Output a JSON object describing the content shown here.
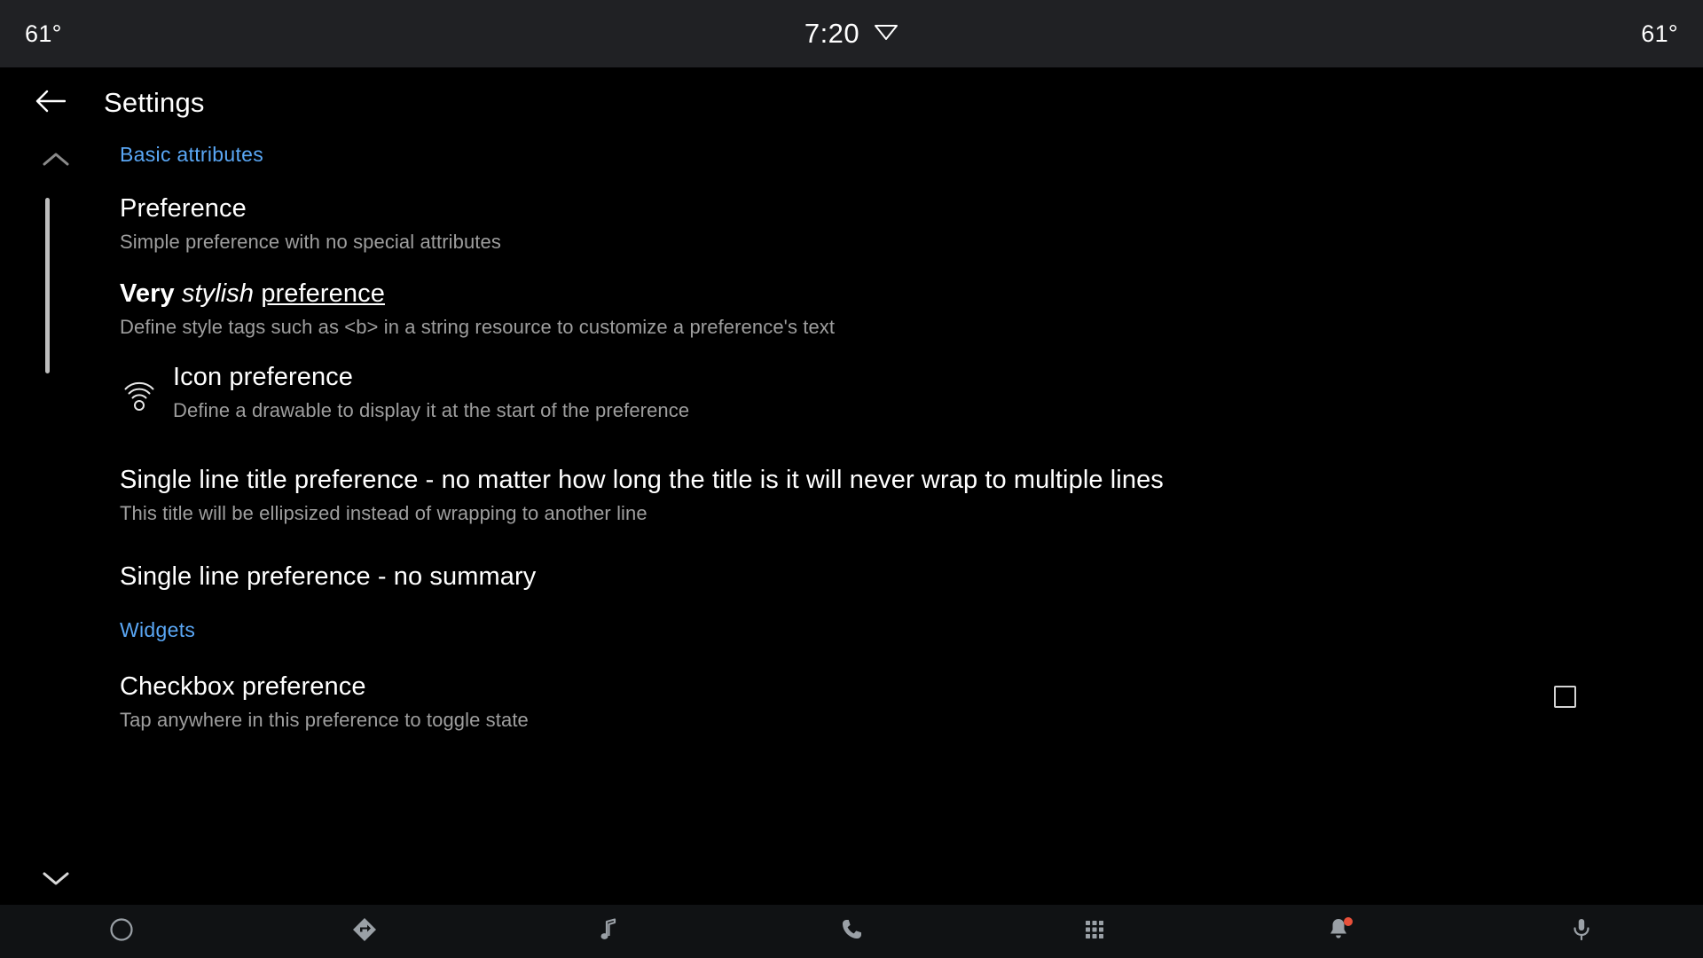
{
  "status_bar": {
    "temp_left": "61°",
    "clock": "7:20",
    "temp_right": "61°",
    "wifi_icon": "wifi-signal-icon",
    "background_color": "#202124"
  },
  "toolbar": {
    "back_icon": "arrow-back-icon",
    "title": "Settings"
  },
  "colors": {
    "accent": "#5aa7f5",
    "background": "#000000",
    "title_text": "#ffffff",
    "summary_text": "#9e9e9e",
    "badge": "#e8503a"
  },
  "scroll": {
    "up_icon": "chevron-up-icon",
    "down_icon": "chevron-down-icon"
  },
  "sections": [
    {
      "header": "Basic attributes",
      "items": [
        {
          "title": "Preference",
          "summary": "Simple preference with no special attributes"
        },
        {
          "title_parts": {
            "bold": "Very",
            "italic": "stylish",
            "underline": "preference"
          },
          "title": "Very stylish preference",
          "summary": "Define style tags such as <b> in a string resource to customize a preference's text"
        },
        {
          "icon": "wifi-tethering-icon",
          "title": "Icon preference",
          "summary": "Define a drawable to display it at the start of the preference"
        },
        {
          "title": "Single line title preference - no matter how long the title is it will never wrap to multiple lines",
          "summary": "This title will be ellipsized instead of wrapping to another line"
        },
        {
          "title": "Single line preference - no summary",
          "summary": ""
        }
      ]
    },
    {
      "header": "Widgets",
      "items": [
        {
          "title": "Checkbox preference",
          "summary": "Tap anywhere in this preference to toggle state",
          "widget": "checkbox",
          "checked": false
        }
      ]
    }
  ],
  "bottom_nav": [
    {
      "icon": "home-circle-icon",
      "label": "Home"
    },
    {
      "icon": "navigation-arrow-icon",
      "label": "Navigation"
    },
    {
      "icon": "music-note-icon",
      "label": "Media"
    },
    {
      "icon": "phone-icon",
      "label": "Phone"
    },
    {
      "icon": "apps-grid-icon",
      "label": "Apps"
    },
    {
      "icon": "notification-bell-icon",
      "label": "Notifications",
      "badge": true
    },
    {
      "icon": "microphone-icon",
      "label": "Assistant"
    }
  ]
}
